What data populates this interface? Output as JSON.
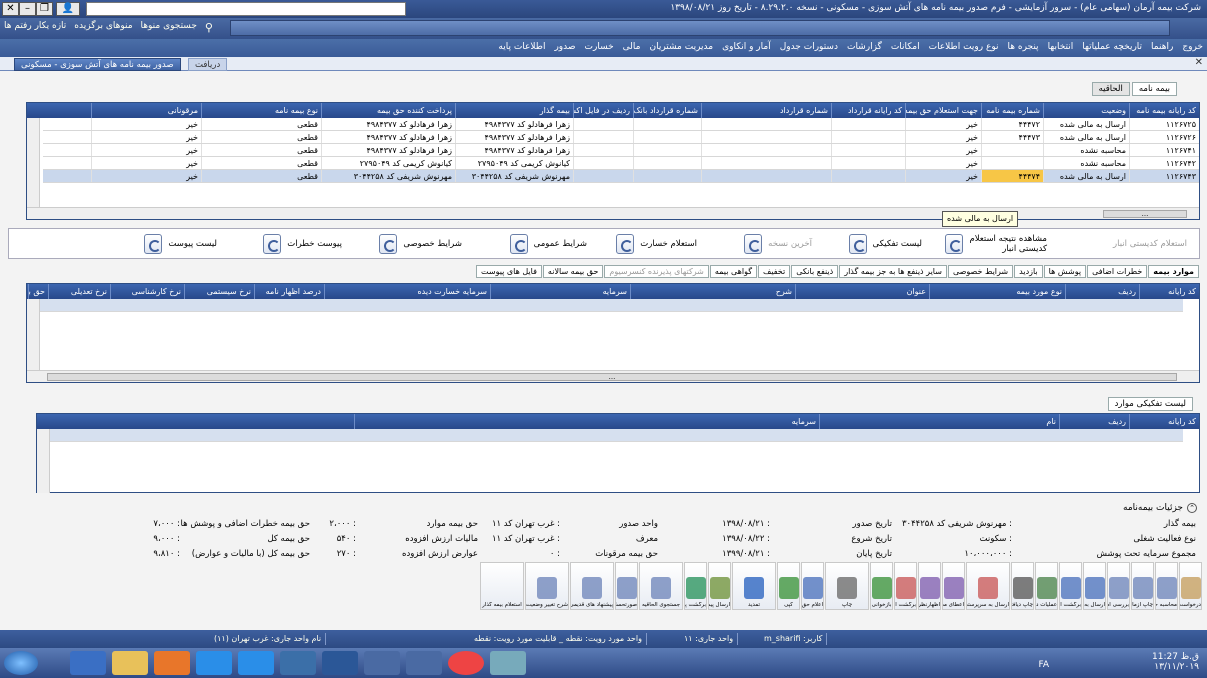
{
  "titlebar": {
    "title": "شرکت بیمه آرمان (سهامی عام) - سرور آزمایشی - فرم صدور بیمه نامه های آتش سوزی - مسکونی - نسخه ۸.۲۹.۲.۰ - تاریخ روز ۱۳۹۸/۰۸/۲۱",
    "search_icon": "search-icon"
  },
  "toolbar2": {
    "refresh": "تازه یکار رفتم ها",
    "favorites": "منوهای برگزیده",
    "menu_search": "جستجوی منوها"
  },
  "menubar": [
    "اطلاعات پایه",
    "صدور",
    "خسارت",
    "مالی",
    "مدیریت مشتریان",
    "آمار و انکاوی",
    "دستورات جدول",
    "گزارشات",
    "امکانات",
    "نوع رویت اطلاعات",
    "پنجره ها",
    "انتخابها",
    "تاریخچه عملیاتها",
    "راهنما",
    "خروج"
  ],
  "doctabs": {
    "active": "صدور بیمه نامه های آتش سوزی - مسکونی",
    "inactive": "دریافت"
  },
  "policy_tabs": [
    "بیمه نامه",
    "الحاقیه"
  ],
  "main_grid": {
    "headers": [
      "کد رایانه بیمه نامه",
      "وضعیت",
      "شماره بیمه نامه",
      "جهت استعلام حق بیمه؟",
      "کد رایانه قرارداد",
      "شماره قرارداد",
      "شماره قرارداد بانک",
      "ردیف در فایل اکسل",
      "بیمه گذار",
      "پرداخت کننده حق بیمه",
      "نوع بیمه نامه",
      "مرقونانی"
    ],
    "rows": [
      [
        "۱۱۲۶۷۲۵",
        "ارسال به مالی شده",
        "۴۴۴۷۲",
        "خیر",
        "",
        "",
        "",
        "",
        "زهرا فرهادلو کد ۴۹۸۴۳۷۷",
        "زهرا فرهادلو کد ۴۹۸۴۳۷۷",
        "قطعی",
        "خیر"
      ],
      [
        "۱۱۲۶۷۲۶",
        "ارسال به مالی شده",
        "۴۴۴۷۳",
        "خیر",
        "",
        "",
        "",
        "",
        "زهرا فرهادلو کد ۴۹۸۴۳۷۷",
        "زهرا فرهادلو کد ۴۹۸۴۳۷۷",
        "قطعی",
        "خیر"
      ],
      [
        "۱۱۲۶۷۴۱",
        "محاسبه نشده",
        "",
        "خیر",
        "",
        "",
        "",
        "",
        "زهرا فرهادلو کد ۴۹۸۴۳۷۷",
        "زهرا فرهادلو کد ۴۹۸۴۳۷۷",
        "قطعی",
        "خیر"
      ],
      [
        "۱۱۲۶۷۴۲",
        "محاسبه نشده",
        "",
        "خیر",
        "",
        "",
        "",
        "",
        "کیانوش کریمی کد ۲۷۹۵۰۴۹",
        "کیانوش کریمی کد ۲۷۹۵۰۴۹",
        "قطعی",
        "خیر"
      ],
      [
        "۱۱۲۶۷۴۳",
        "ارسال به مالی شده",
        "۴۴۴۷۴",
        "خیر",
        "",
        "",
        "",
        "",
        "مهرنوش شریفی کد ۳۰۴۴۲۵۸",
        "مهرنوش شریفی کد ۳۰۴۴۲۵۸",
        "قطعی",
        "خیر"
      ]
    ],
    "tooltip": "ارسال به مالی شده",
    "scroll_label": "..."
  },
  "actions": [
    "استعلام کدیستی انبار",
    "مشاهده نتیجه استعلام کدیستی انبار",
    "لیست تفکیکی",
    "آخرین نسخه",
    "استعلام خسارت",
    "شرایط عمومی",
    "شرایط خصوصی",
    "پیوست خطرات",
    "لیست پیوست"
  ],
  "sub_tabs": [
    "موارد بیمه",
    "خطرات اضافی",
    "پوشش ها",
    "بازدید",
    "شرایط خصوصی",
    "سایر ذینفع ها به جز بیمه گذار",
    "ذینفع بانکی",
    "تخفیف",
    "گواهی بیمه",
    "شرکتهای پذیرنده کنسرسیوم",
    "حق بیمه سالانه",
    "فایل های پیوست"
  ],
  "items_grid": {
    "headers": [
      "کد رایانه",
      "ردیف",
      "نوع مورد بیمه",
      "عنوان",
      "شرح",
      "سرمایه",
      "سرمایه خسارت دیده",
      "درصد اظهار نامه",
      "نرخ سیستمی",
      "نرخ کارشناسی",
      "نرخ تعدیلی",
      "حق بیمه"
    ],
    "scroll_label": "..."
  },
  "breakdown": {
    "label": "لیست تفکیکی موارد",
    "headers": [
      "کد رایانه",
      "ردیف",
      "نام",
      "سرمایه"
    ]
  },
  "details": {
    "title": "جزئیات بیمه‌نامه",
    "col1": [
      [
        "بیمه گذار",
        ": مهرنوش شریفی کد ۳۰۴۴۲۵۸"
      ],
      [
        "نوع فعالیت شغلی",
        ": سکونت"
      ],
      [
        "مجموع سرمایه تحت پوشش",
        ": ۱۰،۰۰۰،۰۰۰"
      ]
    ],
    "col2": [
      [
        "تاریخ صدور",
        ": ۱۳۹۸/۰۸/۲۱"
      ],
      [
        "تاریخ شروع",
        ": ۱۳۹۸/۰۸/۲۲"
      ],
      [
        "تاریخ پایان",
        ": ۱۳۹۹/۰۸/۲۱"
      ]
    ],
    "col3": [
      [
        "واحد صدور",
        ": غرب تهران کد ۱۱"
      ],
      [
        "معرف",
        ": غرب تهران کد ۱۱"
      ],
      [
        "حق بیمه مرقونات",
        ": ۰"
      ]
    ],
    "col4": [
      [
        "حق بیمه موارد",
        ": ۲،۰۰۰"
      ],
      [
        "مالیات ارزش افزوده",
        ": ۵۴۰"
      ],
      [
        "عوارض ارزش افزوده",
        ": ۲۷۰"
      ]
    ],
    "col5": [
      [
        "حق بیمه خطرات اضافی و پوشش ها",
        ": ۷،۰۰۰"
      ],
      [
        "حق بیمه کل",
        ": ۹،۰۰۰"
      ],
      [
        "حق بیمه کل (با مالیات و عوارض)",
        ": ۹،۸۱۰"
      ]
    ]
  },
  "iconbar": [
    "درخواست مجوز",
    "محاسبه حق بیمه",
    "چاپ آزمایشی",
    "بررسی امکان ارسال به مالی",
    "ارسال به مالی",
    "برگشت از مالی",
    "عملیات دریافت",
    "چاپ دیافتی",
    "ارسال به سرپرستی",
    "اعطای مجوز حدوداختیارات",
    "اظهارنظر حدوداختیارات",
    "برگشت از سرپرستی",
    "بازخوانی",
    "چاپ",
    "اعلام حق بیمه",
    "کپی",
    "تمدید",
    "ارسال پیشنهاد",
    "برگشت پیشنهاد",
    "جستجوی الحاقیه",
    "صورتحساب",
    "پیشنهاد های قدیمی",
    "شرح تغییر وضعیت",
    "استعلام بیمه گذار"
  ],
  "statusbar": {
    "user": "کاربر: m_sharifi",
    "unit": "واحد جاری: ۱۱",
    "viewunit": "واحد مورد رویت: نقطه _ قابلیت مورد رویت: نقطه",
    "unitname": "نام واحد جاری: غرب تهران (۱۱)"
  },
  "tray": {
    "lang": "FA",
    "time": "11:27 ق.ظ",
    "date": "۱۳/۱۱/۲۰۱۹"
  },
  "colors": {
    "accent": "#2b467d",
    "highlight": "#f7c646"
  }
}
